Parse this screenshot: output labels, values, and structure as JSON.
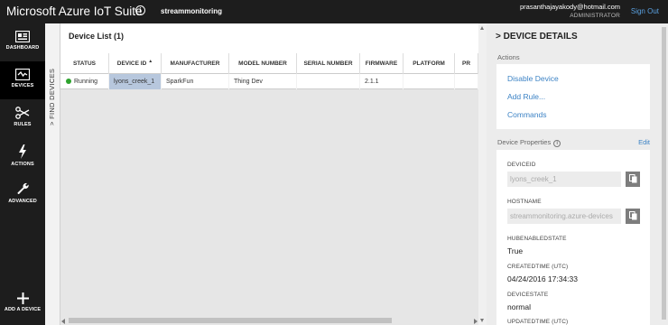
{
  "topbar": {
    "title": "Microsoft Azure IoT Suite",
    "solution_name": "streammonitoring",
    "user_email": "prasanthajayakody@hotmail.com",
    "user_role": "ADMINISTRATOR",
    "sign_out": "Sign Out"
  },
  "nav": {
    "items": [
      {
        "label": "DASHBOARD",
        "icon": "dashboard-icon"
      },
      {
        "label": "DEVICES",
        "icon": "devices-icon"
      },
      {
        "label": "RULES",
        "icon": "rules-icon"
      },
      {
        "label": "ACTIONS",
        "icon": "actions-icon"
      },
      {
        "label": "ADVANCED",
        "icon": "advanced-icon"
      },
      {
        "label": "ADD A DEVICE",
        "icon": "add-device-icon"
      }
    ],
    "active": "DEVICES"
  },
  "find_devices": {
    "label": "FIND DEVICES"
  },
  "device_list": {
    "title": "Device List (1)",
    "columns": [
      "STATUS",
      "DEVICE ID",
      "MANUFACTURER",
      "MODEL NUMBER",
      "SERIAL NUMBER",
      "FIRMWARE",
      "PLATFORM",
      "PR"
    ],
    "rows": [
      {
        "status": "Running",
        "device_id": "lyons_creek_1",
        "manufacturer": "SparkFun",
        "model_number": "Thing Dev",
        "serial_number": "",
        "firmware": "2.1.1",
        "platform": "",
        "pr": ""
      }
    ],
    "status_color": "#2ea32e",
    "selected_color": "#b7c7dd"
  },
  "details": {
    "title": "DEVICE DETAILS",
    "actions_label": "Actions",
    "actions": [
      "Disable Device",
      "Add Rule...",
      "Commands"
    ],
    "properties_label": "Device Properties",
    "edit_label": "Edit",
    "props": {
      "device_id_label": "DEVICEID",
      "device_id_value": "lyons_creek_1",
      "hostname_label": "HOSTNAME",
      "hostname_value": "streammonitoring.azure-devices",
      "hub_enabled_label": "HUBENABLEDSTATE",
      "hub_enabled_value": "True",
      "created_label": "CREATEDTIME (UTC)",
      "created_value": "04/24/2016 17:34:33",
      "device_state_label": "DEVICESTATE",
      "device_state_value": "normal",
      "updated_label": "UPDATEDTIME (UTC)"
    },
    "link_color": "#3d83c5"
  }
}
